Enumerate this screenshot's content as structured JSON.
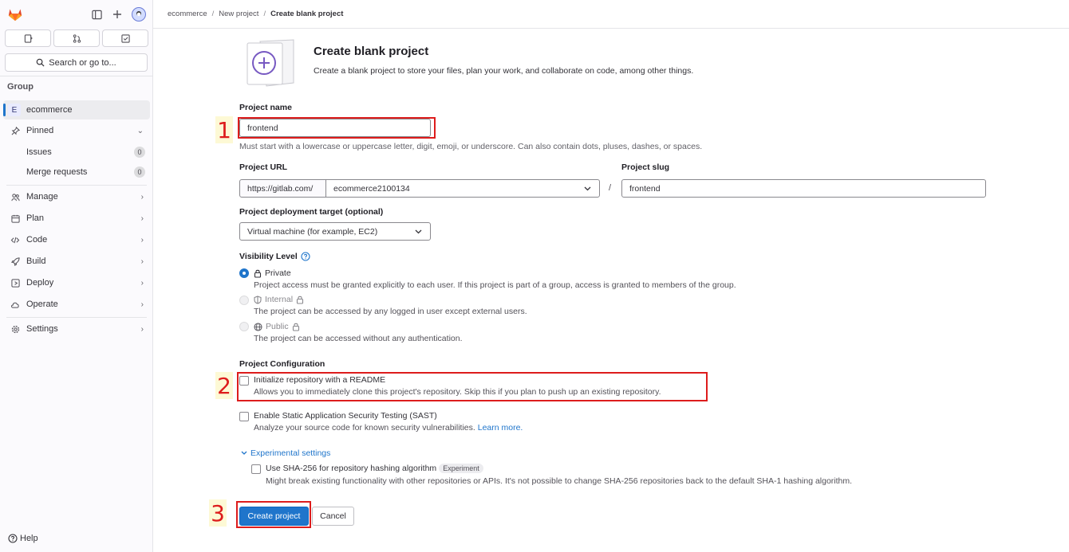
{
  "breadcrumb": [
    "ecommerce",
    "New project",
    "Create blank project"
  ],
  "sidebar": {
    "search_label": "Search or go to...",
    "group_label": "Group",
    "group_item": {
      "badge": "E",
      "label": "ecommerce"
    },
    "pinned": {
      "label": "Pinned",
      "items": [
        {
          "label": "Issues",
          "count": "0"
        },
        {
          "label": "Merge requests",
          "count": "0"
        }
      ]
    },
    "nav": [
      {
        "label": "Manage",
        "icon": "users-icon"
      },
      {
        "label": "Plan",
        "icon": "calendar-icon"
      },
      {
        "label": "Code",
        "icon": "code-icon"
      },
      {
        "label": "Build",
        "icon": "rocket-icon"
      },
      {
        "label": "Deploy",
        "icon": "deploy-icon"
      },
      {
        "label": "Operate",
        "icon": "cloud-icon"
      },
      {
        "label": "Settings",
        "icon": "gear-icon"
      }
    ],
    "help_label": "Help"
  },
  "header": {
    "title": "Create blank project",
    "description": "Create a blank project to store your files, plan your work, and collaborate on code, among other things."
  },
  "form": {
    "project_name_label": "Project name",
    "project_name_value": "frontend",
    "project_name_help": "Must start with a lowercase or uppercase letter, digit, emoji, or underscore. Can also contain dots, pluses, dashes, or spaces.",
    "project_url_label": "Project URL",
    "url_prefix": "https://gitlab.com/",
    "namespace": "ecommerce2100134",
    "slash": "/",
    "project_slug_label": "Project slug",
    "project_slug_value": "frontend",
    "deploy_label": "Project deployment target (optional)",
    "deploy_value": "Virtual machine (for example, EC2)",
    "visibility_label": "Visibility Level",
    "visibility": [
      {
        "label": "Private",
        "desc": "Project access must be granted explicitly to each user. If this project is part of a group, access is granted to members of the group."
      },
      {
        "label": "Internal",
        "desc": "The project can be accessed by any logged in user except external users."
      },
      {
        "label": "Public",
        "desc": "The project can be accessed without any authentication."
      }
    ],
    "config_label": "Project Configuration",
    "readme_label": "Initialize repository with a README",
    "readme_desc": "Allows you to immediately clone this project's repository. Skip this if you plan to push up an existing repository.",
    "sast_label": "Enable Static Application Security Testing (SAST)",
    "sast_desc": "Analyze your source code for known security vulnerabilities.",
    "sast_link": "Learn more.",
    "experimental_label": "Experimental settings",
    "sha_label": "Use SHA-256 for repository hashing algorithm",
    "sha_badge": "Experiment",
    "sha_desc": "Might break existing functionality with other repositories or APIs. It's not possible to change SHA-256 repositories back to the default SHA-1 hashing algorithm.",
    "create_button": "Create project",
    "cancel_button": "Cancel"
  },
  "annotations": [
    "1",
    "2",
    "3"
  ],
  "colors": {
    "primary": "#1f75cb",
    "annotation": "#dd1c1c"
  }
}
